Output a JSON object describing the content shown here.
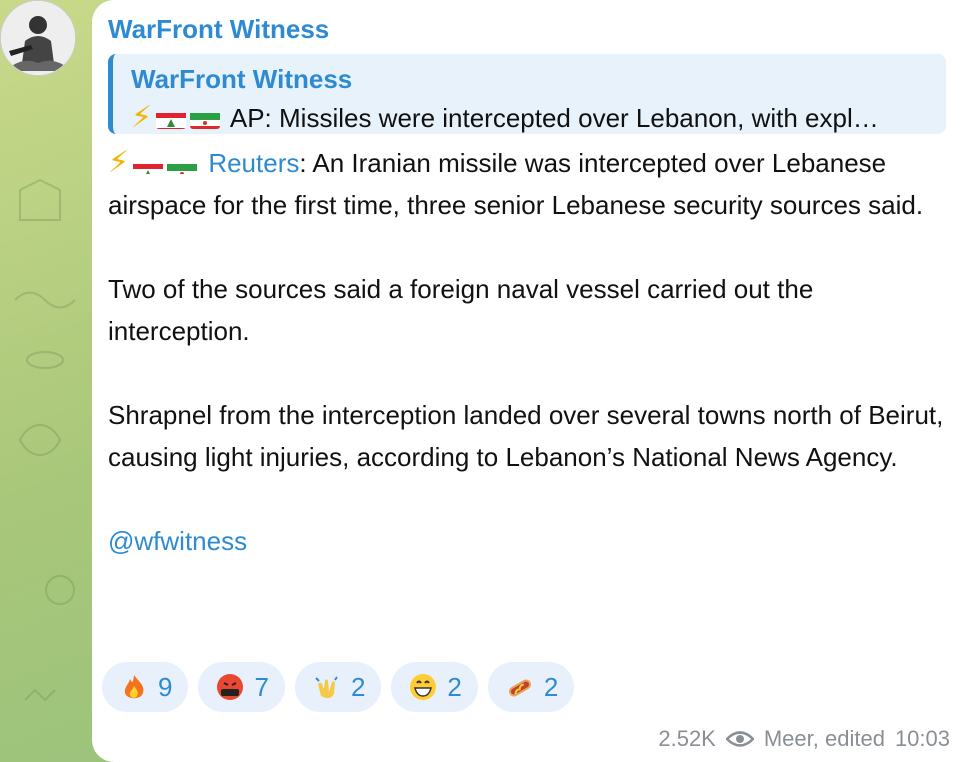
{
  "channel": {
    "name": "WarFront Witness",
    "handle": "@wfwitness"
  },
  "reply": {
    "name": "WarFront Witness",
    "text": "AP: Missiles were intercepted over Lebanon, with expl…"
  },
  "message": {
    "source_link": "Reuters",
    "p1_rest": ": An Iranian missile was intercepted over Lebanese airspace for the first time, three senior Lebanese security sources said.",
    "p2": "Two of the sources said a foreign naval vessel carried out the interception.",
    "p3": "Shrapnel from the interception landed over several towns north of Beirut, causing light injuries, according to Lebanon’s National News Agency."
  },
  "reactions": [
    {
      "emoji": "fire-emoji",
      "count": "9"
    },
    {
      "emoji": "swearing-face-emoji",
      "count": "7"
    },
    {
      "emoji": "clapping-hands-emoji",
      "count": "2"
    },
    {
      "emoji": "grinning-face-emoji",
      "count": "2"
    },
    {
      "emoji": "hotdog-emoji",
      "count": "2"
    }
  ],
  "meta": {
    "views": "2.52K",
    "edited": "Meer, edited",
    "time": "10:03"
  },
  "colors": {
    "accent": "#2f8bd1",
    "reaction_bg": "#e7f0fb",
    "meta": "#8a8f96"
  }
}
